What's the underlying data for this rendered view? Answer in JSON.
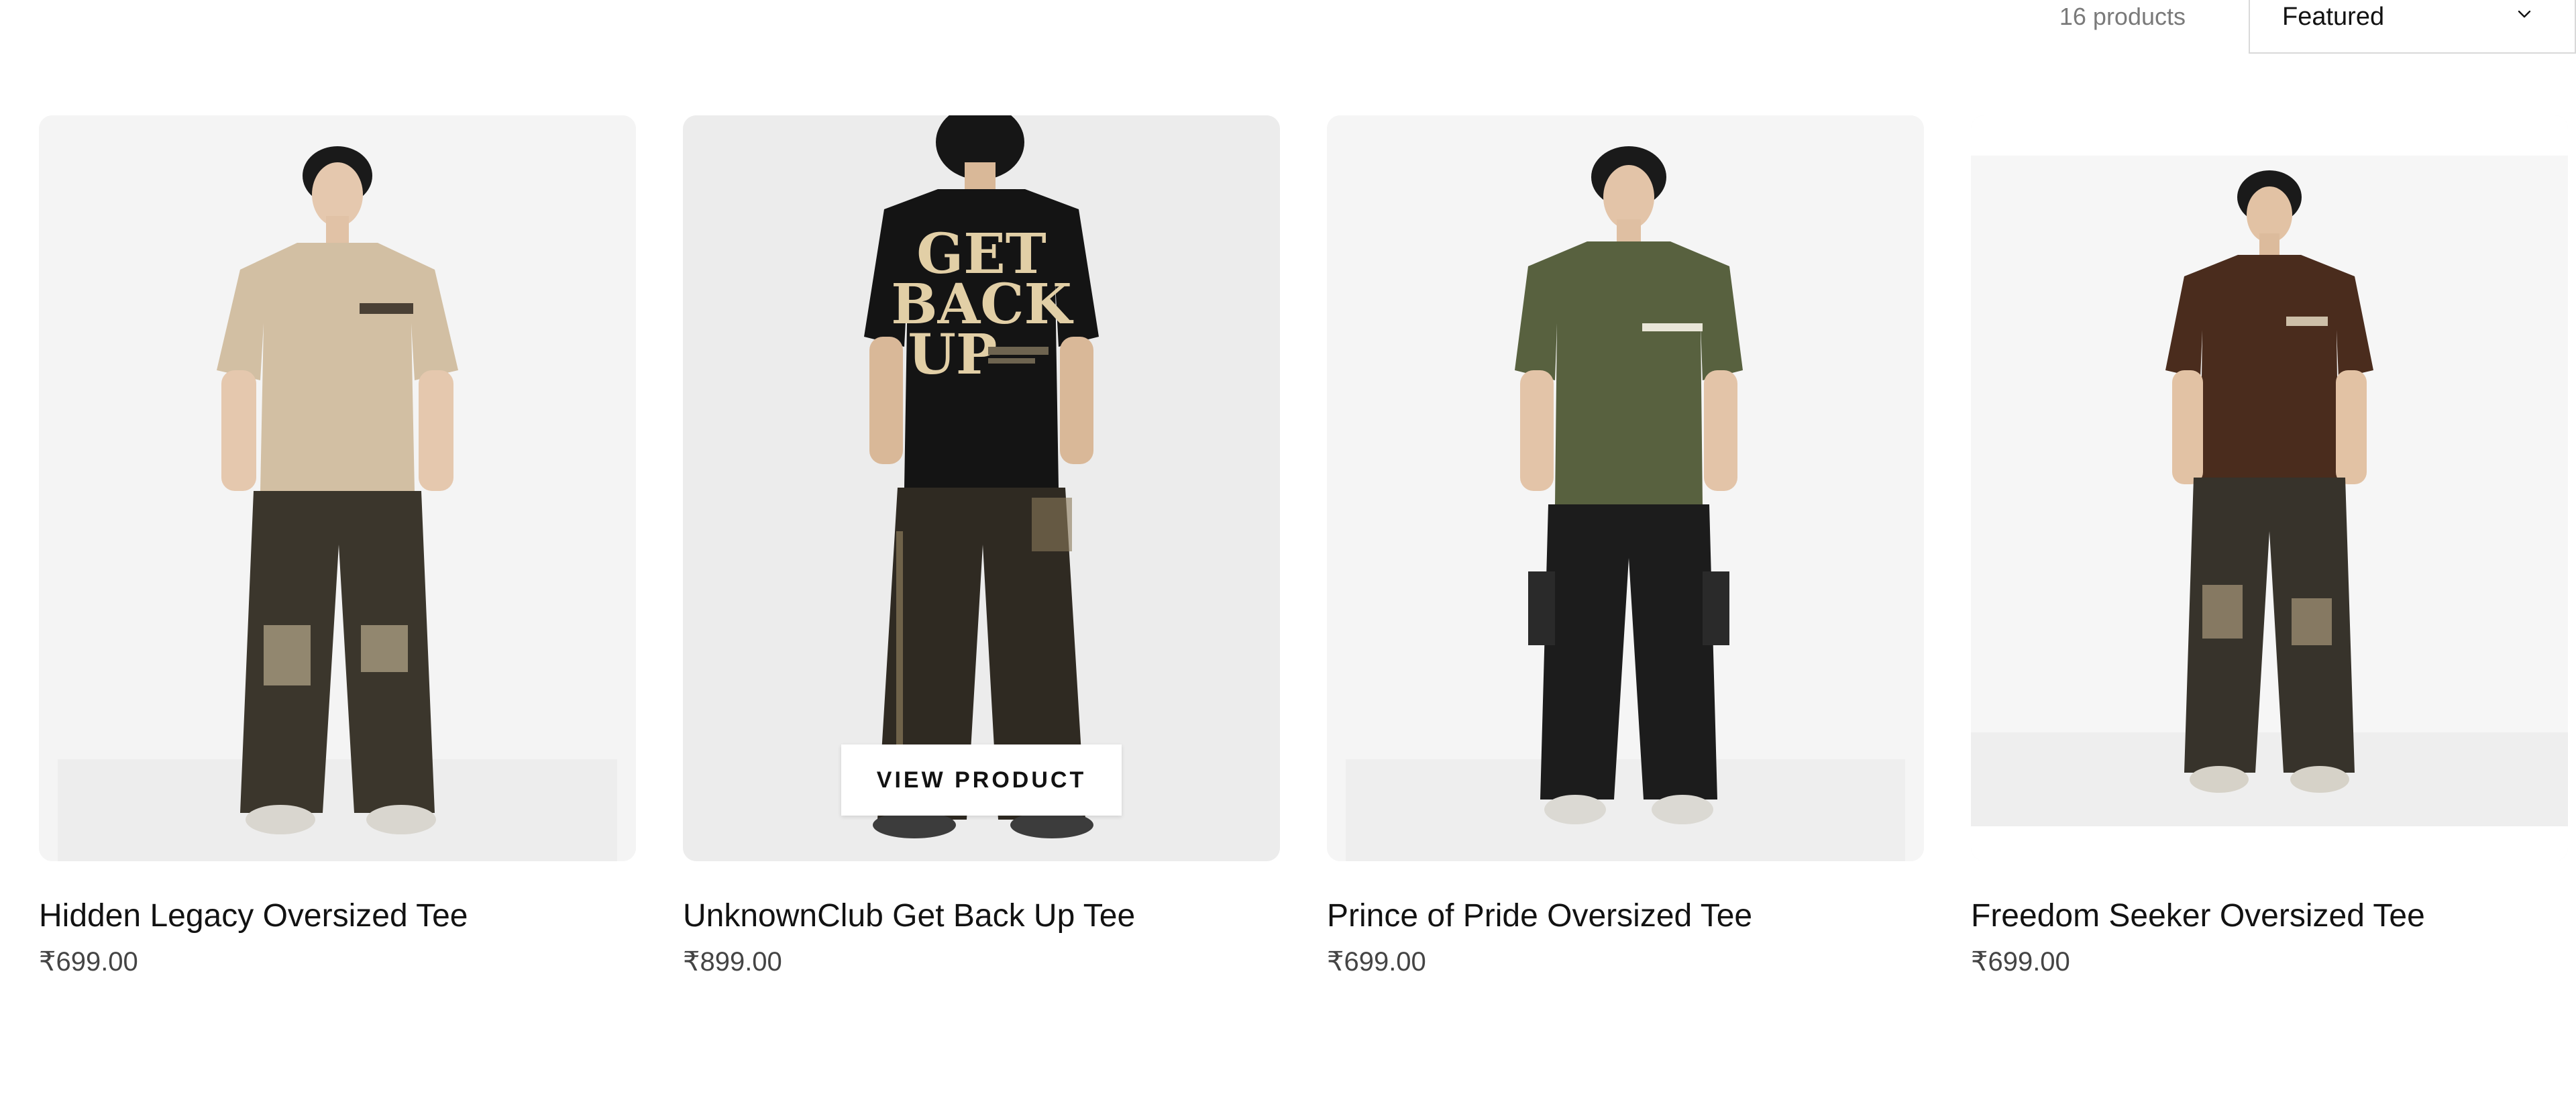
{
  "toolbar": {
    "product_count": "16 products",
    "sort": {
      "selected": "Featured",
      "icon": "chevron-down-icon"
    }
  },
  "products": [
    {
      "title": "Hidden Legacy Oversized Tee",
      "price": "₹699.00",
      "tee_color": "#d2bfa3",
      "pants_color": "#3b362c",
      "background": "#f4f4f4"
    },
    {
      "title": "UnknownClub Get Back Up Tee",
      "price": "₹899.00",
      "tee_color": "#141414",
      "pants_color": "#2f2a22",
      "background": "#ececec",
      "print_text": [
        "GET",
        "BACK",
        "UP"
      ],
      "hover_button": "VIEW PRODUCT"
    },
    {
      "title": "Prince of Pride Oversized Tee",
      "price": "₹699.00",
      "tee_color": "#58613f",
      "pants_color": "#1c1c1c",
      "background": "#f5f5f5"
    },
    {
      "title": "Freedom Seeker Oversized Tee",
      "price": "₹699.00",
      "tee_color": "#4a2c1d",
      "pants_color": "#37332b",
      "background": "#f6f6f6"
    }
  ]
}
